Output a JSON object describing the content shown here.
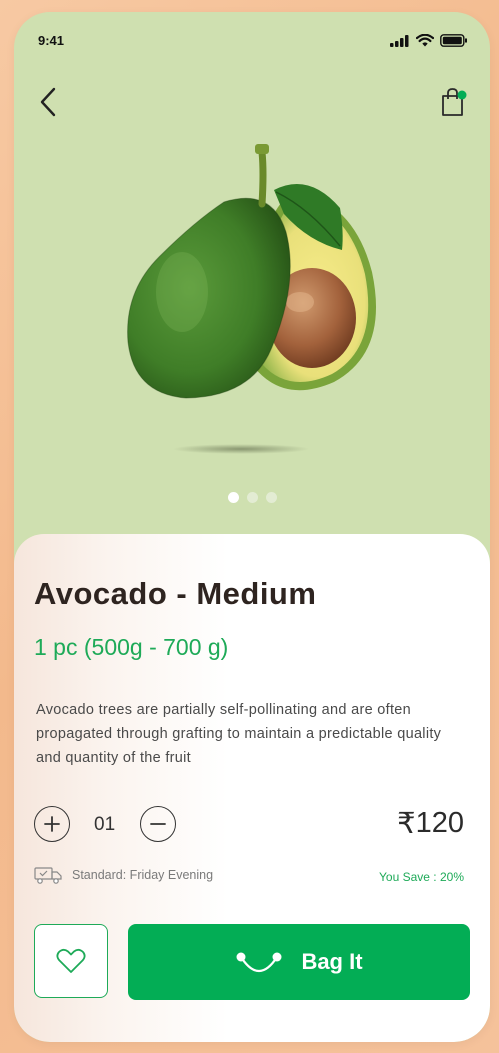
{
  "status_bar": {
    "time": "9:41"
  },
  "product": {
    "title": "Avocado - Medium",
    "weight": "1 pc (500g - 700 g)",
    "description": "Avocado trees are partially self-pollinating and are often propagated through grafting to maintain a predictable quality and quantity of the fruit",
    "quantity": "01",
    "currency": "₹",
    "price": "120",
    "delivery": "Standard: Friday Evening",
    "savings": "You Save : 20%"
  },
  "carousel": {
    "count": 3,
    "active_index": 0
  },
  "actions": {
    "bag_label": "Bag It"
  },
  "colors": {
    "accent": "#03ad55",
    "hero_bg": "#cfe0b0",
    "title": "#2e2420"
  },
  "icons": [
    "back-arrow-icon",
    "shopping-bag-icon",
    "plus-icon",
    "minus-icon",
    "truck-icon",
    "heart-icon",
    "smile-bag-icon"
  ]
}
